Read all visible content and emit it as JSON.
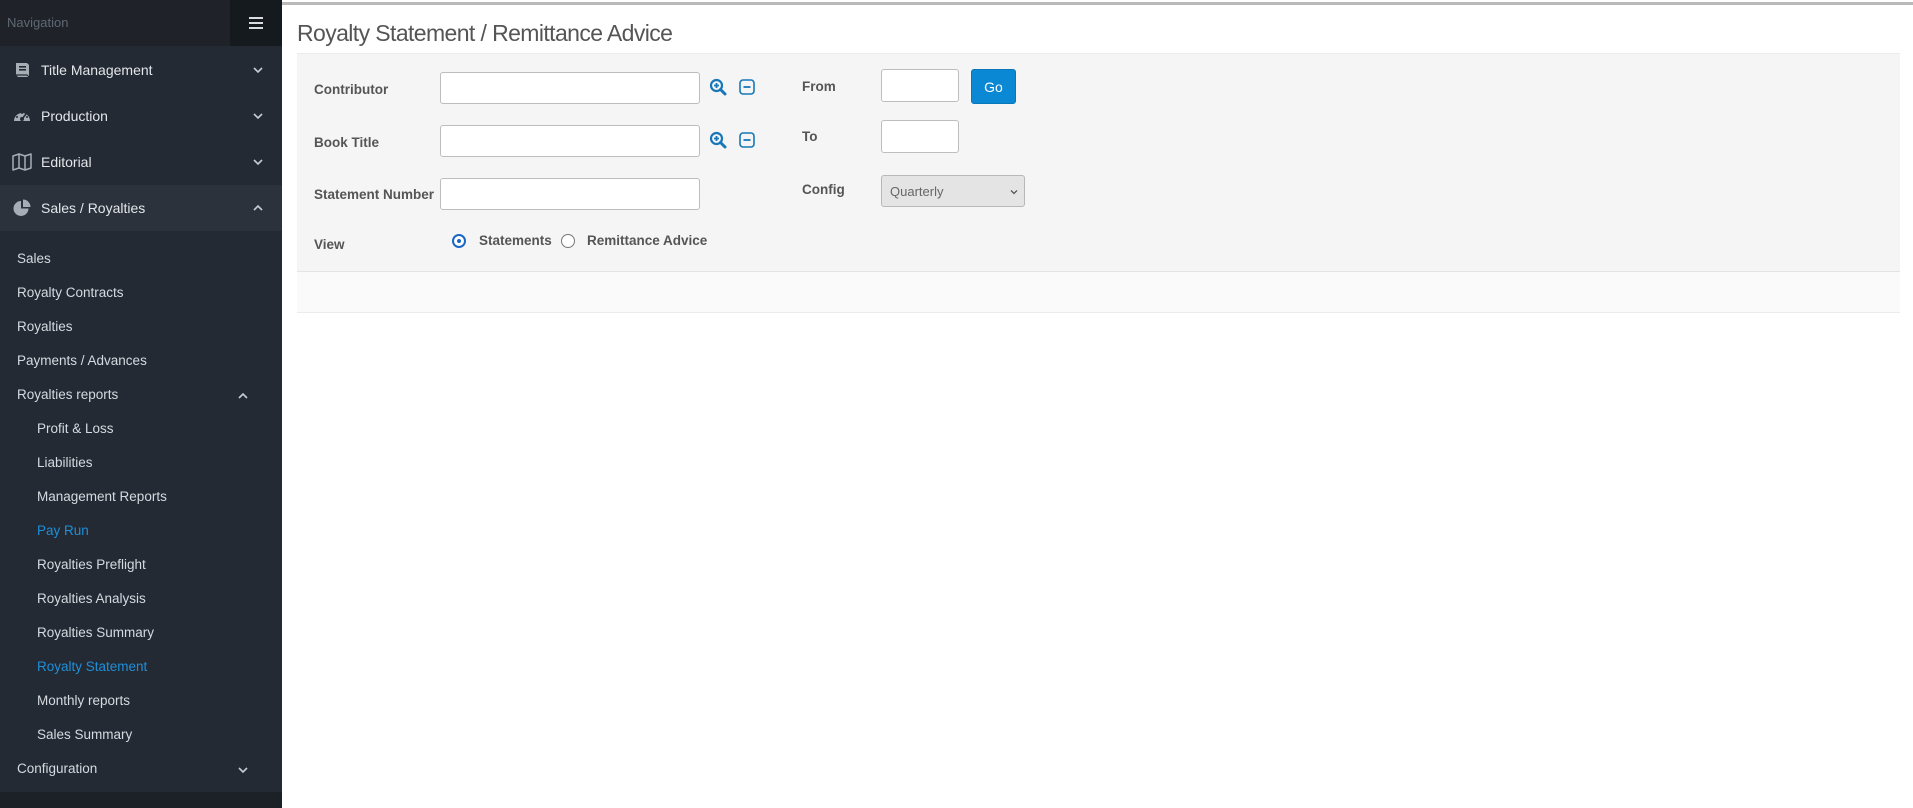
{
  "sidebar": {
    "header": "Navigation",
    "sections": [
      {
        "label": "Title Management",
        "icon": "book-icon"
      },
      {
        "label": "Production",
        "icon": "dashboard-icon"
      },
      {
        "label": "Editorial",
        "icon": "map-icon"
      },
      {
        "label": "Sales / Royalties",
        "icon": "pie-chart-icon"
      }
    ],
    "items": [
      {
        "label": "Sales"
      },
      {
        "label": "Royalty Contracts"
      },
      {
        "label": "Royalties"
      },
      {
        "label": "Payments / Advances"
      },
      {
        "label": "Royalties reports"
      }
    ],
    "report_items": [
      {
        "label": "Profit & Loss"
      },
      {
        "label": "Liabilities"
      },
      {
        "label": "Management Reports"
      },
      {
        "label": "Pay Run"
      },
      {
        "label": "Royalties Preflight"
      },
      {
        "label": "Royalties Analysis"
      },
      {
        "label": "Royalties Summary"
      },
      {
        "label": "Royalty Statement"
      },
      {
        "label": "Monthly reports"
      },
      {
        "label": "Sales Summary"
      }
    ],
    "configuration": {
      "label": "Configuration"
    },
    "active_color": "#1e8fd8"
  },
  "page": {
    "title": "Royalty Statement / Remittance Advice"
  },
  "form": {
    "contributor": {
      "label": "Contributor",
      "value": ""
    },
    "book_title": {
      "label": "Book Title",
      "value": ""
    },
    "statement_number": {
      "label": "Statement Number",
      "value": ""
    },
    "view": {
      "label": "View",
      "options": [
        {
          "label": "Statements",
          "selected": true
        },
        {
          "label": "Remittance Advice",
          "selected": false
        }
      ]
    },
    "from": {
      "label": "From",
      "value": ""
    },
    "to": {
      "label": "To",
      "value": ""
    },
    "config": {
      "label": "Config",
      "selected": "Quarterly"
    },
    "go_label": "Go"
  },
  "colors": {
    "accent": "#0b88d3",
    "sidebar": "#242a33"
  }
}
